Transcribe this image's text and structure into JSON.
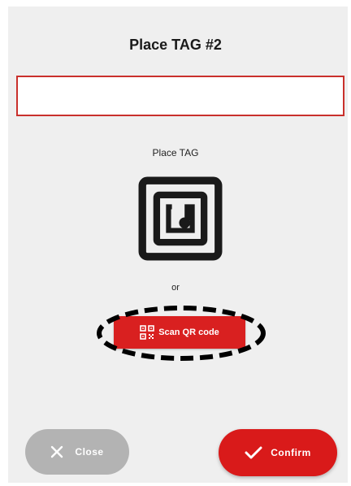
{
  "header": {
    "title": "Place TAG #2"
  },
  "tag_input": {
    "value": "",
    "placeholder": ""
  },
  "nfc": {
    "label": "Place TAG",
    "icon": "nfc-tag-icon"
  },
  "separator": {
    "label": "or"
  },
  "scan": {
    "label": "Scan QR code",
    "icon": "qr-code-icon"
  },
  "footer": {
    "close_label": "Close",
    "close_icon": "close-icon",
    "confirm_label": "Confirm",
    "confirm_icon": "checkmark-icon"
  },
  "colors": {
    "accent_red": "#d92020",
    "input_border": "#c9302c",
    "close_gray": "#b3b3b3",
    "background": "#efefef"
  }
}
